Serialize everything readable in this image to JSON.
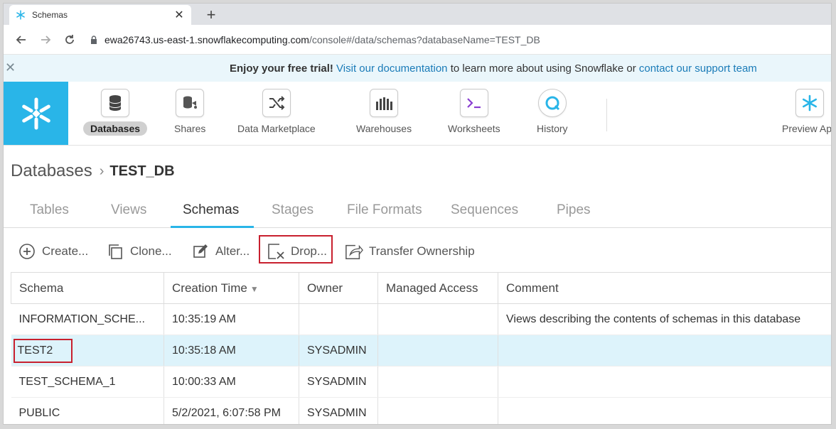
{
  "browser": {
    "tab_title": "Schemas",
    "new_tab": "+",
    "close": "✕",
    "url_host": "ewa26743.us-east-1.snowflakecomputing.com",
    "url_path": "/console#/data/schemas?databaseName=TEST_DB"
  },
  "banner": {
    "close": "✕",
    "bold": "Enjoy your free trial!",
    "link1": "Visit our documentation",
    "mid": " to learn more about using Snowflake or ",
    "link2": "contact our support team"
  },
  "nav": {
    "items": [
      {
        "label": "Databases",
        "icon": "database-icon"
      },
      {
        "label": "Shares",
        "icon": "shares-icon"
      },
      {
        "label": "Data Marketplace",
        "icon": "shuffle-icon"
      },
      {
        "label": "Warehouses",
        "icon": "warehouse-icon"
      },
      {
        "label": "Worksheets",
        "icon": "terminal-icon"
      },
      {
        "label": "History",
        "icon": "history-icon"
      },
      {
        "label": "Preview App",
        "icon": "snowflake-icon"
      }
    ]
  },
  "breadcrumb": {
    "root": "Databases",
    "sep": "›",
    "current": "TEST_DB"
  },
  "subtabs": [
    "Tables",
    "Views",
    "Schemas",
    "Stages",
    "File Formats",
    "Sequences",
    "Pipes"
  ],
  "toolbar": {
    "create": "Create...",
    "clone": "Clone...",
    "alter": "Alter...",
    "drop": "Drop...",
    "transfer": "Transfer Ownership"
  },
  "table": {
    "headers": [
      "Schema",
      "Creation Time",
      "Owner",
      "Managed Access",
      "Comment"
    ],
    "sort_indicator": "▼",
    "rows": [
      [
        "INFORMATION_SCHE...",
        "10:35:19 AM",
        "",
        "",
        "Views describing the contents of schemas in this database"
      ],
      [
        "TEST2",
        "10:35:18 AM",
        "SYSADMIN",
        "",
        ""
      ],
      [
        "TEST_SCHEMA_1",
        "10:00:33 AM",
        "SYSADMIN",
        "",
        ""
      ],
      [
        "PUBLIC",
        "5/2/2021, 6:07:58 PM",
        "SYSADMIN",
        "",
        ""
      ]
    ]
  },
  "colors": {
    "accent": "#29b5e8",
    "highlight": "#c8202e",
    "selected_row": "#ddf3fb"
  }
}
